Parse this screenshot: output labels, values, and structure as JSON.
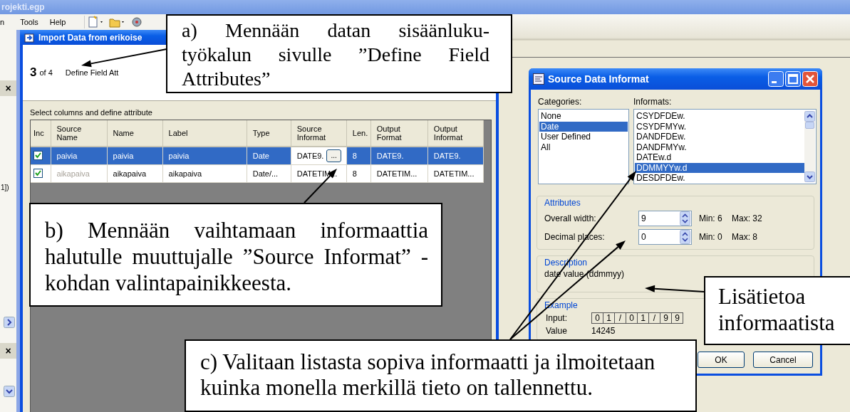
{
  "app": {
    "title": "rojekti.egp",
    "menu": [
      "n",
      "Tools",
      "Help"
    ]
  },
  "side_panel": {
    "close_buttons": [
      "×",
      "×"
    ],
    "fragment": "1])"
  },
  "import_window": {
    "title": "Import Data from erikoise",
    "step": "3",
    "step_total": "of 4",
    "step_title": "Define Field Att",
    "instruction": "Select columns and define attribute",
    "table": {
      "columns": [
        "Inc",
        "Source Name",
        "Name",
        "Label",
        "Type",
        "Source Informat",
        "Len.",
        "Output Format",
        "Output Informat"
      ],
      "rows": [
        {
          "selected": true,
          "included": true,
          "source_greyed": false,
          "cells": [
            "",
            "paivia",
            "paivia",
            "paivia",
            "Date",
            "DATE9.",
            "8",
            "DATE9.",
            "DATE9."
          ],
          "edit_button": "..."
        },
        {
          "selected": false,
          "included": true,
          "source_greyed": true,
          "cells": [
            "",
            "aikapaiva",
            "aikapaiva",
            "aikapaiva",
            "Date/...",
            "DATETIM...",
            "8",
            "DATETIM...",
            "DATETIM..."
          ]
        }
      ]
    }
  },
  "informat_dialog": {
    "title": "Source Data Informat",
    "categories_label": "Categories:",
    "categories": [
      {
        "label": "None",
        "selected": false
      },
      {
        "label": "Date",
        "selected": true
      },
      {
        "label": "User Defined",
        "selected": false
      },
      {
        "label": "All",
        "selected": false
      }
    ],
    "informats_label": "Informats:",
    "informats": [
      {
        "label": "CSYDFDEw.",
        "selected": false
      },
      {
        "label": "CSYDFMYw.",
        "selected": false
      },
      {
        "label": "DANDFDEw.",
        "selected": false
      },
      {
        "label": "DANDFMYw.",
        "selected": false
      },
      {
        "label": "DATEw.d",
        "selected": false
      },
      {
        "label": "DDMMYYw.d",
        "selected": true
      },
      {
        "label": "DESDFDEw.",
        "selected": false
      }
    ],
    "attributes": {
      "title": "Attributes",
      "fields": [
        {
          "label": "Overall width:",
          "value": "9",
          "min": "Min: 6",
          "max": "Max: 32"
        },
        {
          "label": "Decimal places:",
          "value": "0",
          "min": "Min: 0",
          "max": "Max: 8"
        }
      ]
    },
    "description": {
      "title": "Description",
      "text": "date value (ddmmyy)"
    },
    "example": {
      "title": "Example",
      "input_label": "Input:",
      "input_chars": [
        "0",
        "1",
        "/",
        "0",
        "1",
        "/",
        "9",
        "9"
      ],
      "value_label": "Value",
      "value": "14245"
    },
    "buttons": [
      "OK",
      "Cancel"
    ]
  },
  "callouts": [
    {
      "text": "a) Mennään datan sisäänluku-työkalun sivulle ”Define Field Attributes”"
    },
    {
      "text": "b) Mennään vaihtamaan informaattia halutulle muuttujalle ”Source Informat” - kohdan valintapainikkeesta."
    },
    {
      "text": "c) Valitaan listasta sopiva informaatti ja ilmoitetaan kuinka monella merkillä tieto on tallennettu."
    },
    {
      "text": "Lisätietoa informaatista"
    }
  ]
}
